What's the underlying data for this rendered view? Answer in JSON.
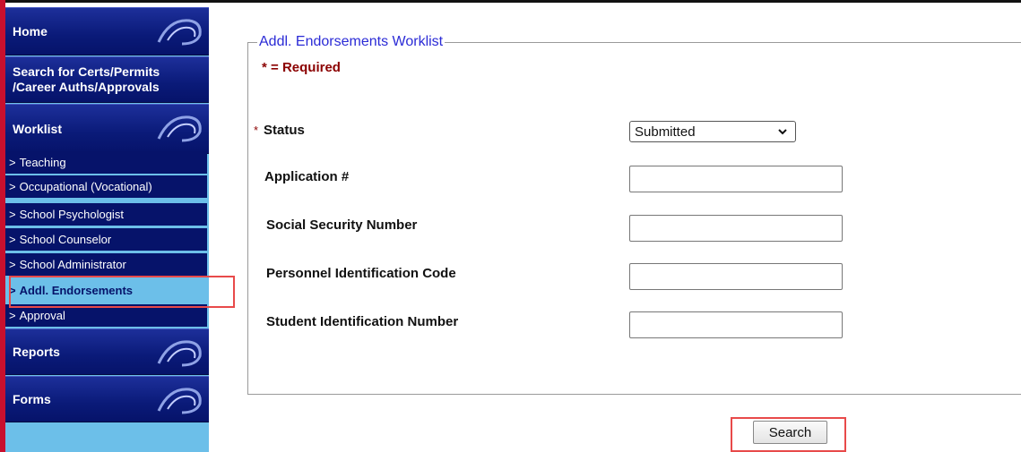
{
  "sidebar": {
    "home": "Home",
    "search_line1": "Search for Certs/Permits",
    "search_line2": "/Career Auths/Approvals",
    "worklist": "Worklist",
    "worklist_items": [
      {
        "prefix": ">",
        "label": "Teaching"
      },
      {
        "prefix": ">",
        "label": "Occupational (Vocational)"
      },
      {
        "prefix": ">",
        "label": "School Psychologist"
      },
      {
        "prefix": ">",
        "label": "School Counselor"
      },
      {
        "prefix": ">",
        "label": "School Administrator"
      },
      {
        "prefix": ">",
        "label": "Addl. Endorsements"
      },
      {
        "prefix": ">",
        "label": "Approval"
      }
    ],
    "reports": "Reports",
    "forms": "Forms"
  },
  "form": {
    "legend": "Addl. Endorsements Worklist",
    "required_star": "*",
    "required_text": " = Required",
    "status_star": "*",
    "status_label": "Status",
    "status_value": "Submitted",
    "application_label": "Application #",
    "application_value": "",
    "ssn_label": "Social Security Number",
    "ssn_value": "",
    "pic_label": "Personnel Identification Code",
    "pic_value": "",
    "sin_label": "Student Identification Number",
    "sin_value": ""
  },
  "search_button": "Search",
  "colors": {
    "nav_dark": "#06136a",
    "nav_light": "#6cbfe9",
    "legend": "#2b2bd6",
    "required": "#8b0000",
    "annotation": "#e84a4a"
  }
}
